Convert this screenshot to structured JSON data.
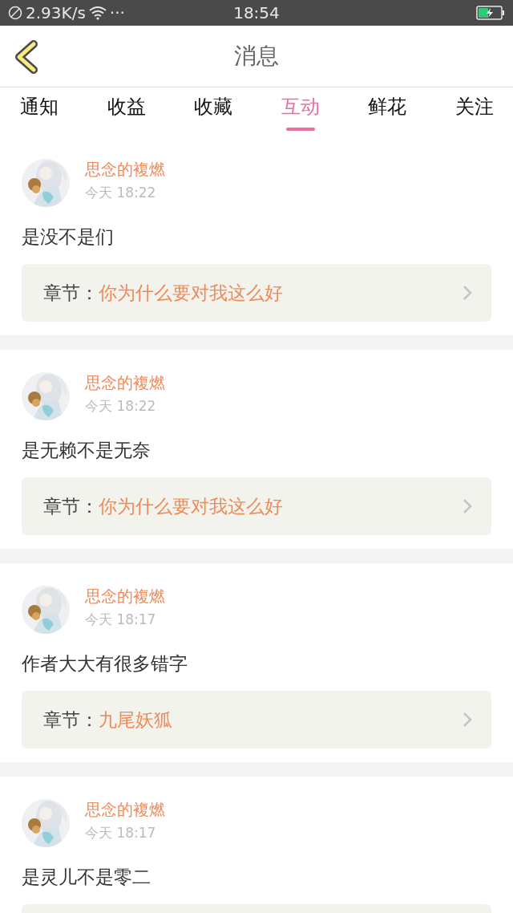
{
  "status_bar": {
    "speed": "2.93K/s",
    "dots": "···",
    "time": "18:54",
    "battery": {
      "charging": true
    }
  },
  "header": {
    "title": "消息"
  },
  "tabs": [
    {
      "label": "通知",
      "selected": false
    },
    {
      "label": "收益",
      "selected": false
    },
    {
      "label": "收藏",
      "selected": false
    },
    {
      "label": "互动",
      "selected": true
    },
    {
      "label": "鲜花",
      "selected": false
    },
    {
      "label": "关注",
      "selected": false
    }
  ],
  "messages": [
    {
      "user": "思念的複燃",
      "time": "今天 18:22",
      "comment": "是没不是们",
      "chapter_label": "章节：",
      "chapter": "你为什么要对我这么好"
    },
    {
      "user": "思念的複燃",
      "time": "今天 18:22",
      "comment": "是无赖不是无奈",
      "chapter_label": "章节：",
      "chapter": "你为什么要对我这么好"
    },
    {
      "user": "思念的複燃",
      "time": "今天 18:17",
      "comment": "作者大大有很多错字",
      "chapter_label": "章节：",
      "chapter": "九尾妖狐"
    },
    {
      "user": "思念的複燃",
      "time": "今天 18:17",
      "comment": "是灵儿不是零二"
    }
  ]
}
